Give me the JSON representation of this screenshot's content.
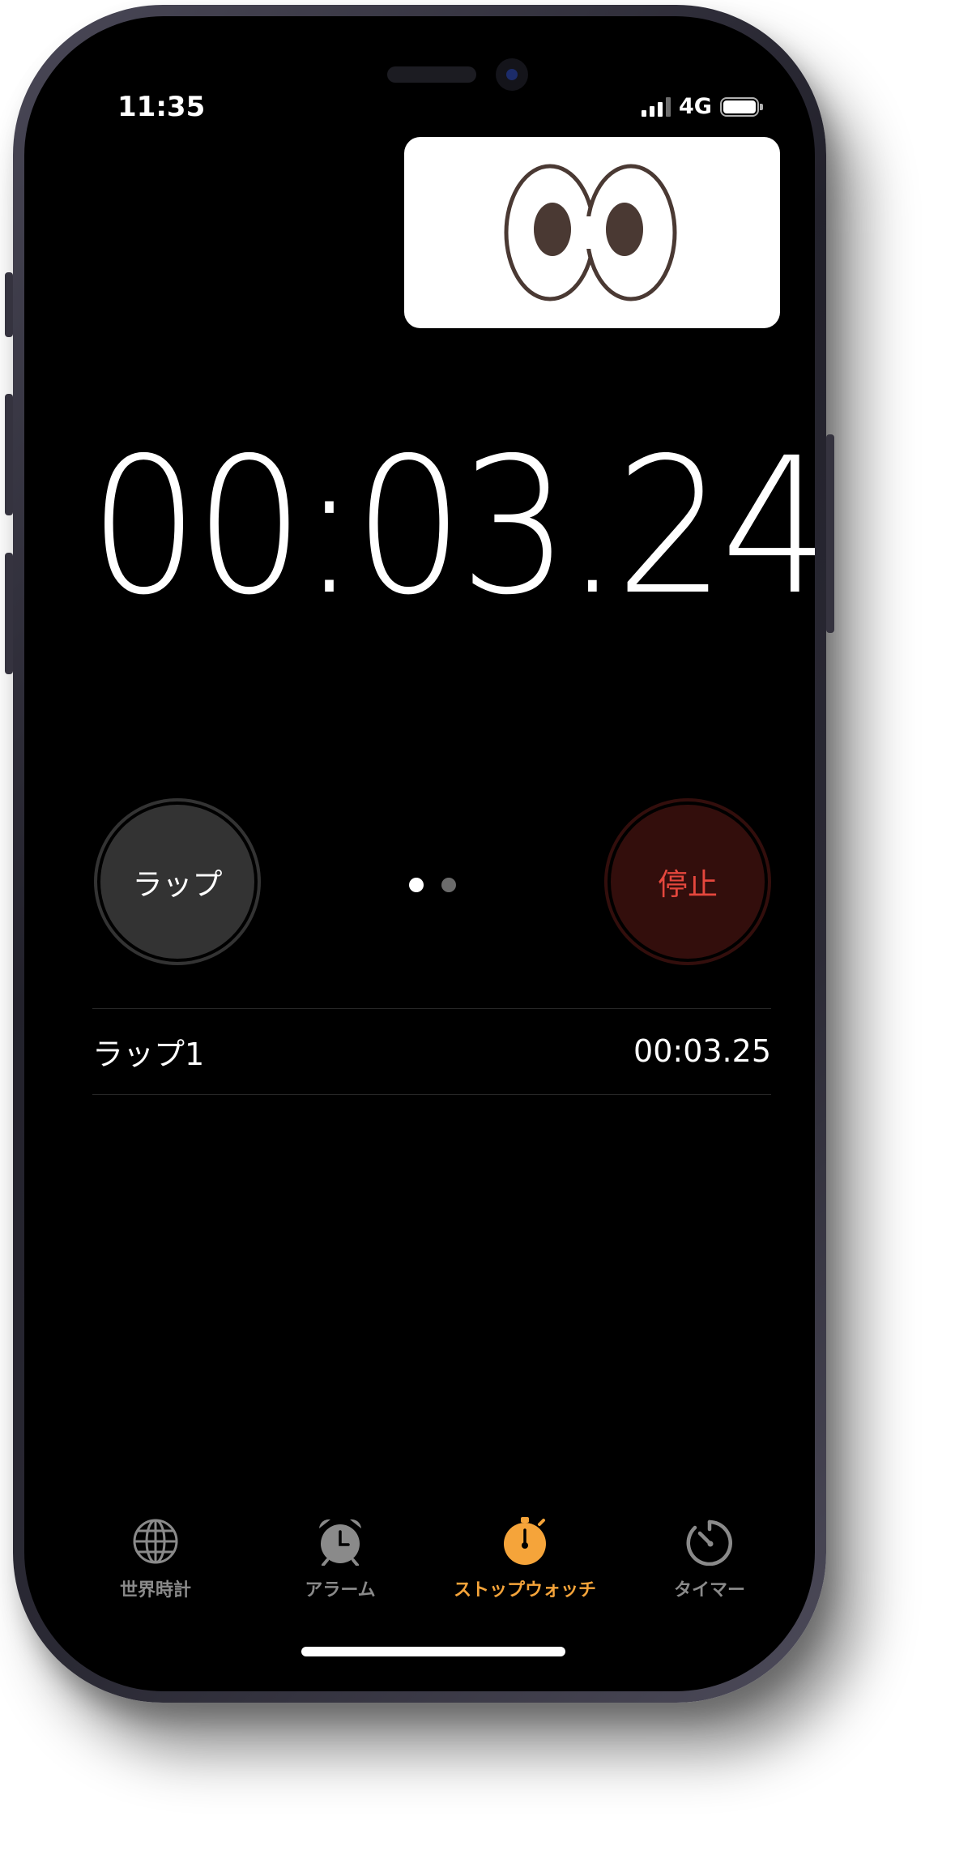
{
  "status_bar": {
    "time": "11:35",
    "network": "4G"
  },
  "stopwatch": {
    "elapsed": "00:03.24",
    "page_dots": {
      "count": 2,
      "active_index": 0
    }
  },
  "buttons": {
    "lap_label": "ラップ",
    "stop_label": "停止"
  },
  "laps": [
    {
      "label": "ラップ1",
      "time": "00:03.25"
    }
  ],
  "tab_bar": {
    "items": [
      {
        "label": "世界時計",
        "icon": "globe-icon",
        "active": false
      },
      {
        "label": "アラーム",
        "icon": "alarm-clock-icon",
        "active": false
      },
      {
        "label": "ストップウォッチ",
        "icon": "stopwatch-icon",
        "active": true
      },
      {
        "label": "タイマー",
        "icon": "timer-icon",
        "active": false
      }
    ]
  },
  "colors": {
    "accent": "#f5a43a",
    "stop_text": "#e5473d",
    "stop_bg": "#330e0c",
    "lap_bg": "#333333",
    "inactive_tab": "#8a8a8a"
  }
}
